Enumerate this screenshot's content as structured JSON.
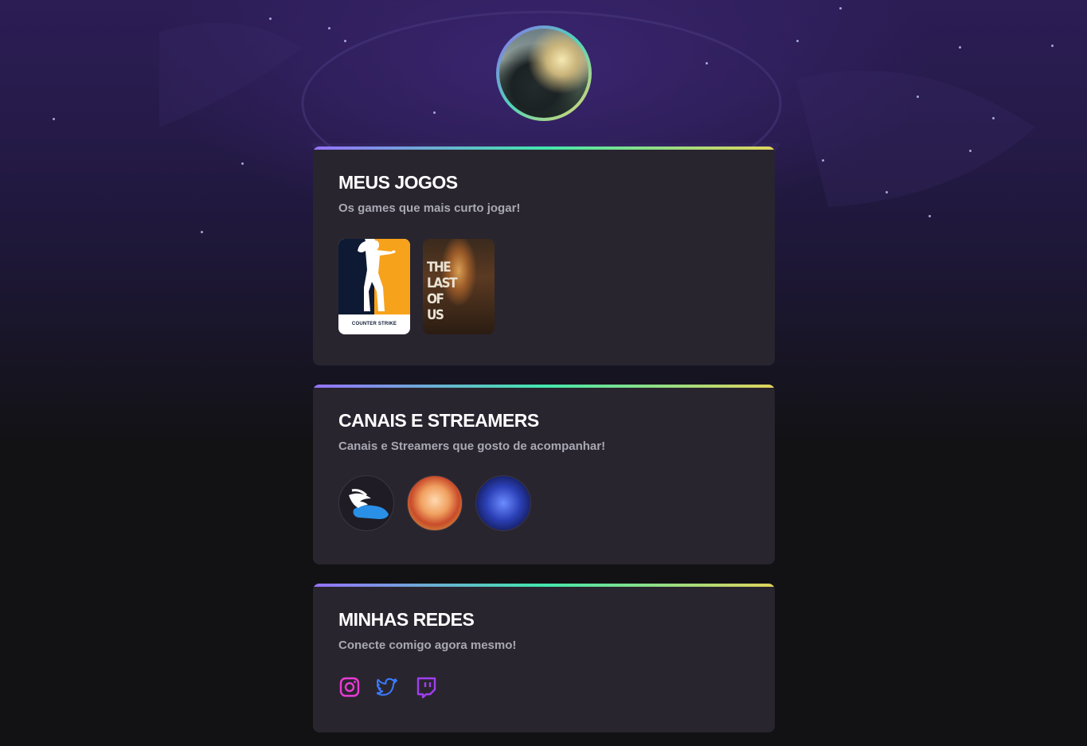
{
  "profile": {
    "avatar_icon": "profile-photo"
  },
  "games_card": {
    "title": "MEUS JOGOS",
    "subtitle": "Os games que mais curto jogar!",
    "games": [
      {
        "name": "Counter-Strike",
        "logo_text": "COUNTER STRIKE"
      },
      {
        "name": "The Last of Us",
        "cover_text": "THE LAST OF US"
      }
    ]
  },
  "streamers_card": {
    "title": "CANAIS E STREAMERS",
    "subtitle": "Canais e Streamers que gosto de acompanhar!",
    "streamers": [
      {
        "icon": "winged-shoe-icon"
      },
      {
        "icon": "streamer-avatar"
      },
      {
        "icon": "streamer-avatar"
      }
    ]
  },
  "social_card": {
    "title": "MINHAS REDES",
    "subtitle": "Conecte comigo agora mesmo!",
    "links": [
      {
        "icon": "instagram-icon",
        "color": "#e93bd4"
      },
      {
        "icon": "twitter-icon",
        "color": "#3a7bfd"
      },
      {
        "icon": "twitch-icon",
        "color": "#a13ef0"
      }
    ]
  },
  "colors": {
    "background": "#121214",
    "card": "#29252f",
    "gradient": [
      "#9572fc",
      "#43e7ad",
      "#e2d45c"
    ],
    "title": "#ffffff",
    "subtitle": "#a8a8b3"
  }
}
